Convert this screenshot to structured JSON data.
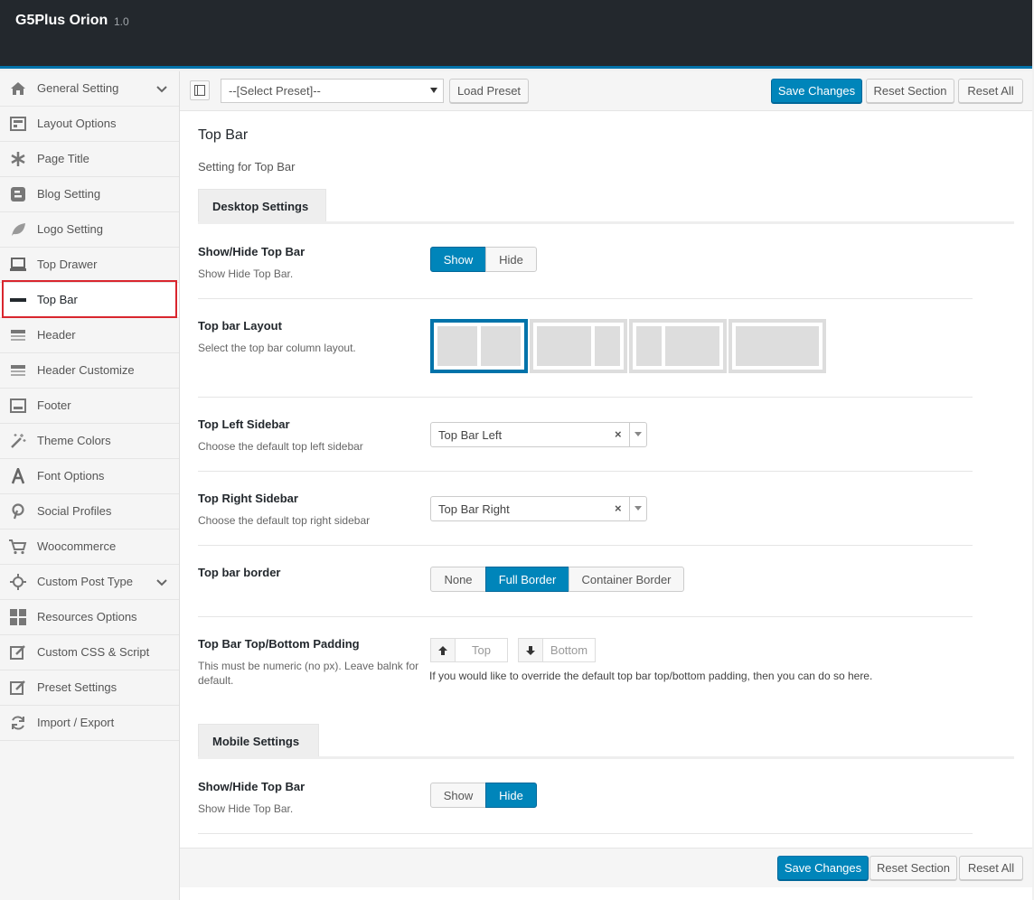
{
  "header": {
    "title": "G5Plus Orion",
    "version": "1.0"
  },
  "sidebar": {
    "items": [
      {
        "label": "General Setting",
        "icon": "home-icon",
        "chevron": true
      },
      {
        "label": "Layout Options",
        "icon": "layout-icon"
      },
      {
        "label": "Page Title",
        "icon": "asterisk-icon"
      },
      {
        "label": "Blog Setting",
        "icon": "blogger-icon"
      },
      {
        "label": "Logo Setting",
        "icon": "leaf-icon"
      },
      {
        "label": "Top Drawer",
        "icon": "laptop-icon"
      },
      {
        "label": "Top Bar",
        "icon": "minus-icon",
        "active": true
      },
      {
        "label": "Header",
        "icon": "header-icon"
      },
      {
        "label": "Header Customize",
        "icon": "header-customize-icon"
      },
      {
        "label": "Footer",
        "icon": "footer-icon"
      },
      {
        "label": "Theme Colors",
        "icon": "magic-wand-icon"
      },
      {
        "label": "Font Options",
        "icon": "font-icon"
      },
      {
        "label": "Social Profiles",
        "icon": "pinterest-icon"
      },
      {
        "label": "Woocommerce",
        "icon": "cart-icon"
      },
      {
        "label": "Custom Post Type",
        "icon": "crosshair-icon",
        "chevron": true
      },
      {
        "label": "Resources Options",
        "icon": "grid-icon"
      },
      {
        "label": "Custom CSS & Script",
        "icon": "edit-icon"
      },
      {
        "label": "Preset Settings",
        "icon": "edit-icon"
      },
      {
        "label": "Import / Export",
        "icon": "refresh-icon"
      }
    ]
  },
  "toolbar": {
    "preset_value": "--[Select Preset]--",
    "load_preset": "Load Preset",
    "save_changes": "Save Changes",
    "reset_section": "Reset Section",
    "reset_all": "Reset All"
  },
  "section": {
    "title": "Top Bar",
    "description": "Setting for Top Bar"
  },
  "desktop": {
    "tab": "Desktop Settings",
    "show_hide": {
      "label": "Show/Hide Top Bar",
      "desc": "Show Hide Top Bar.",
      "options": [
        "Show",
        "Hide"
      ],
      "selected": "Show"
    },
    "layout": {
      "label": "Top bar Layout",
      "desc": "Select the top bar column layout.",
      "selected_index": 0
    },
    "left_sidebar": {
      "label": "Top Left Sidebar",
      "desc": "Choose the default top left sidebar",
      "value": "Top Bar Left",
      "clear": "×"
    },
    "right_sidebar": {
      "label": "Top Right Sidebar",
      "desc": "Choose the default top right sidebar",
      "value": "Top Bar Right",
      "clear": "×"
    },
    "border": {
      "label": "Top bar border",
      "options": [
        "None",
        "Full Border",
        "Container Border"
      ],
      "selected": "Full Border"
    },
    "padding": {
      "label": "Top Bar Top/Bottom Padding",
      "desc": "This must be numeric (no px). Leave balnk for default.",
      "top_placeholder": "Top",
      "bottom_placeholder": "Bottom",
      "note": "If you would like to override the default top bar top/bottom padding, then you can do so here."
    }
  },
  "mobile": {
    "tab": "Mobile Settings",
    "show_hide": {
      "label": "Show/Hide Top Bar",
      "desc": "Show Hide Top Bar.",
      "options": [
        "Show",
        "Hide"
      ],
      "selected": "Hide"
    }
  },
  "footer": {
    "save_changes": "Save Changes",
    "reset_section": "Reset Section",
    "reset_all": "Reset All"
  },
  "colors": {
    "accent": "#0085ba",
    "header_bg": "#23282d",
    "highlight_border": "#d9262e"
  }
}
